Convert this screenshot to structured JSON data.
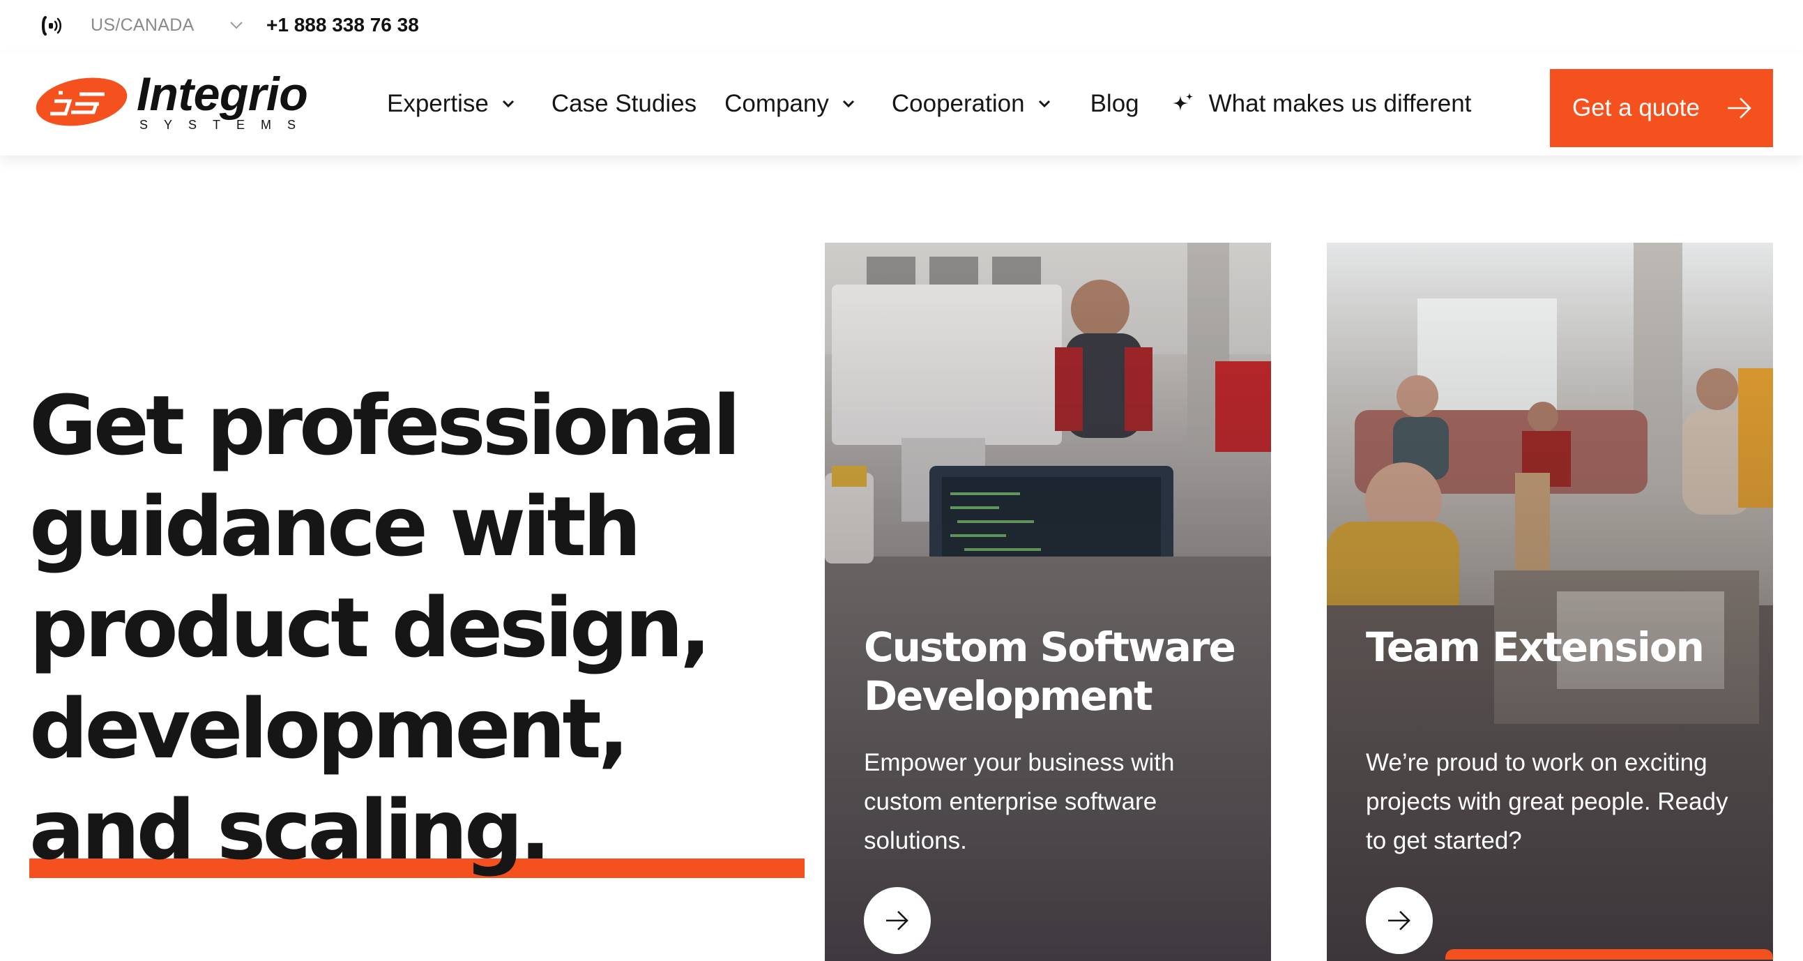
{
  "topbar": {
    "region": "US/CANADA",
    "phone": "+1 888 338 76 38",
    "phone_icon": "phone-ring-icon"
  },
  "logo": {
    "mark": "IS",
    "name": "Integrio",
    "subtitle": "SYSTEMS"
  },
  "nav": {
    "items": [
      {
        "label": "Expertise",
        "has_dropdown": true
      },
      {
        "label": "Case Studies",
        "has_dropdown": false
      },
      {
        "label": "Company",
        "has_dropdown": true
      },
      {
        "label": "Cooperation",
        "has_dropdown": true
      },
      {
        "label": "Blog",
        "has_dropdown": false
      },
      {
        "label": "What makes us different",
        "has_dropdown": false,
        "icon": "sparkle-icon"
      }
    ],
    "cta_label": "Get a quote"
  },
  "hero": {
    "lines": [
      "Get professional",
      "guidance with",
      "product design,",
      "development,",
      "and scaling."
    ]
  },
  "cards": [
    {
      "title": "Custom Software Development",
      "description": "Empower your business with custom enterprise software solutions."
    },
    {
      "title": "Team Extension",
      "description": "We’re proud to work on exciting projects with great people. Ready to get started?"
    }
  ],
  "colors": {
    "accent": "#f4511e",
    "text": "#161616",
    "muted": "#8a8a8a"
  }
}
